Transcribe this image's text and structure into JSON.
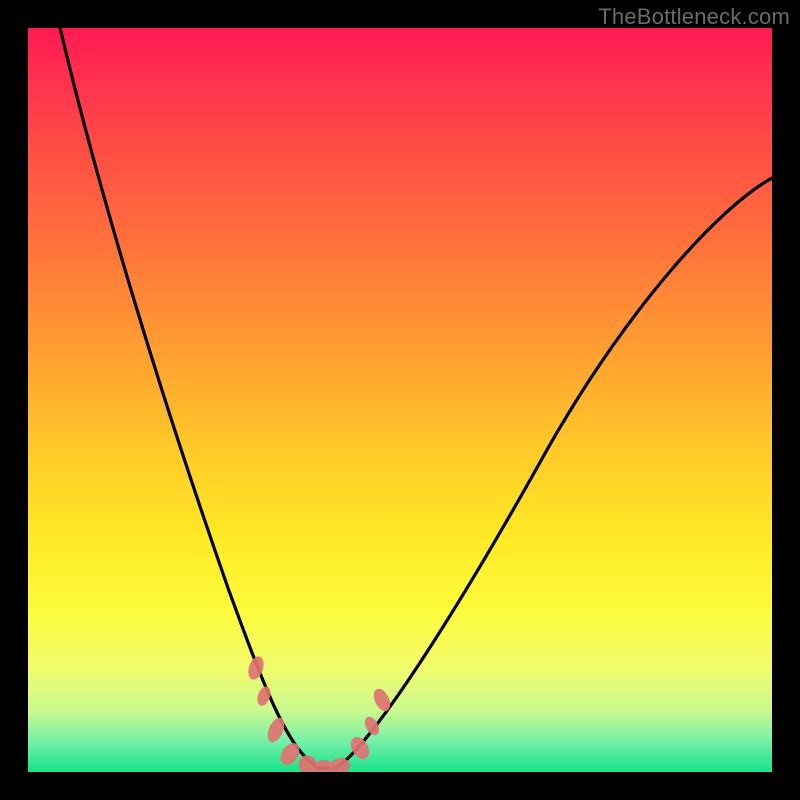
{
  "watermark": "TheBottleneck.com",
  "colors": {
    "background": "#000000",
    "gradient_top": "#ff1a52",
    "gradient_bottom": "#16e28a",
    "curve": "#000000",
    "markers": "#e07272"
  },
  "chart_data": {
    "type": "line",
    "title": "",
    "xlabel": "",
    "ylabel": "",
    "xlim": [
      0,
      100
    ],
    "ylim": [
      0,
      100
    ],
    "x": [
      0,
      5,
      10,
      15,
      20,
      25,
      30,
      33,
      36,
      39,
      41,
      45,
      50,
      55,
      60,
      70,
      80,
      90,
      100
    ],
    "y": [
      100,
      86,
      72,
      58,
      44,
      30,
      16,
      8,
      2,
      0,
      0,
      3,
      10,
      18,
      26,
      40,
      52,
      62,
      70
    ],
    "series": [
      {
        "name": "bottleneck-curve",
        "x_ref": "x",
        "y_ref": "y"
      }
    ],
    "markers": [
      {
        "x": 30,
        "y": 12
      },
      {
        "x": 31,
        "y": 8
      },
      {
        "x": 33,
        "y": 4
      },
      {
        "x": 35,
        "y": 1
      },
      {
        "x": 37,
        "y": 0
      },
      {
        "x": 39,
        "y": 0
      },
      {
        "x": 41,
        "y": 0
      },
      {
        "x": 44,
        "y": 4
      },
      {
        "x": 45.5,
        "y": 7
      },
      {
        "x": 47,
        "y": 11
      }
    ],
    "annotations": []
  }
}
